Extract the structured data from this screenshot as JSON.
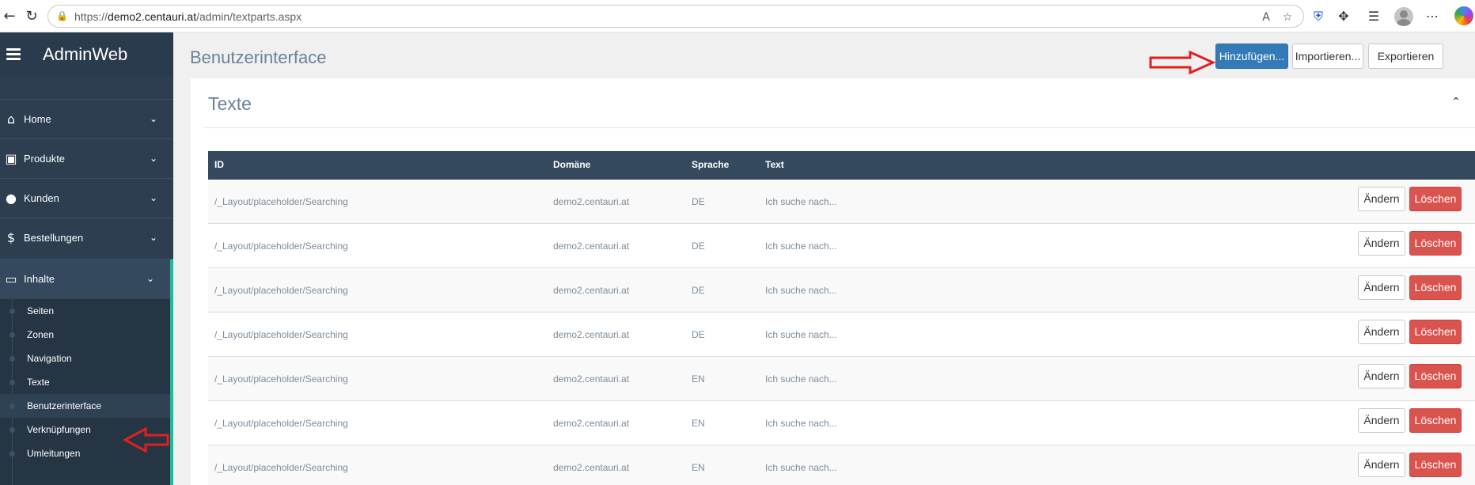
{
  "browser": {
    "url_scheme": "https://",
    "url_host": "demo2.centauri.at",
    "url_path": "/admin/textparts.aspx"
  },
  "sidebar": {
    "brand": "AdminWeb",
    "menu": [
      {
        "label": "Home",
        "icon": "home-icon"
      },
      {
        "label": "Produkte",
        "icon": "box-icon"
      },
      {
        "label": "Kunden",
        "icon": "user-icon"
      },
      {
        "label": "Bestellungen",
        "icon": "dollar-icon"
      },
      {
        "label": "Inhalte",
        "icon": "monitor-icon"
      }
    ],
    "submenu": [
      "Seiten",
      "Zonen",
      "Navigation",
      "Texte",
      "Benutzerinterface",
      "Verknüpfungen",
      "Umleitungen"
    ]
  },
  "header": {
    "title": "Benutzerinterface",
    "add_label": "Hinzufügen...",
    "import_label": "Importieren...",
    "export_label": "Exportieren"
  },
  "card": {
    "title": "Texte"
  },
  "table": {
    "columns": [
      "ID",
      "Domäne",
      "Sprache",
      "Text"
    ],
    "edit_label": "Ändern",
    "delete_label": "Löschen",
    "rows": [
      {
        "id": "/_Layout/placeholder/Searching",
        "domain": "demo2.centauri.at",
        "lang": "DE",
        "text": "Ich suche nach..."
      },
      {
        "id": "/_Layout/placeholder/Searching",
        "domain": "demo2.centauri.at",
        "lang": "DE",
        "text": "Ich suche nach..."
      },
      {
        "id": "/_Layout/placeholder/Searching",
        "domain": "demo2.centauri.at",
        "lang": "DE",
        "text": "Ich suche nach..."
      },
      {
        "id": "/_Layout/placeholder/Searching",
        "domain": "demo2.centauri.at",
        "lang": "DE",
        "text": "Ich suche nach..."
      },
      {
        "id": "/_Layout/placeholder/Searching",
        "domain": "demo2.centauri.at",
        "lang": "EN",
        "text": "Ich suche nach..."
      },
      {
        "id": "/_Layout/placeholder/Searching",
        "domain": "demo2.centauri.at",
        "lang": "EN",
        "text": "Ich suche nach..."
      },
      {
        "id": "/_Layout/placeholder/Searching",
        "domain": "demo2.centauri.at",
        "lang": "EN",
        "text": "Ich suche nach..."
      }
    ]
  },
  "colors": {
    "sidebar_bg": "#2c3e50",
    "accent": "#1abc9c",
    "primary": "#337ab7",
    "danger": "#d9534f",
    "table_header": "#34495e",
    "annotation_arrow": "#e02020"
  }
}
